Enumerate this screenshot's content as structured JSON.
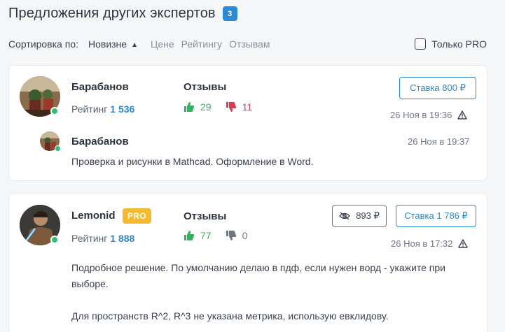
{
  "header": {
    "title": "Предложения других экспертов",
    "count": "3"
  },
  "sort": {
    "label": "Сортировка по:",
    "options": [
      "Новизне",
      "Цене",
      "Рейтингу",
      "Отзывам"
    ],
    "pro_only_label": "Только PRO"
  },
  "offers": [
    {
      "name": "Барабанов",
      "rating_label": "Рейтинг",
      "rating_value": "1 536",
      "reviews_label": "Отзывы",
      "reviews_up": "29",
      "reviews_down": "11",
      "bid_label": "Ставка 800 ₽",
      "time": "26 Ноя в 19:36",
      "message": {
        "name": "Барабанов",
        "time": "26 Ноя в 19:37",
        "text": "Проверка и рисунки в Mathcad. Оформление в Word."
      }
    },
    {
      "name": "Lemonid",
      "pro_label": "PRO",
      "rating_label": "Рейтинг",
      "rating_value": "1 888",
      "reviews_label": "Отзывы",
      "reviews_up": "77",
      "reviews_down": "0",
      "price_label": "893 ₽",
      "bid_label": "Ставка 1 786 ₽",
      "time": "26 Ноя в 17:32",
      "message": {
        "text_line1": "Подробное решение. По умолчанию делаю в пдф, если нужен ворд - укажите при",
        "text_line2": "выборе.",
        "text_line3": "Для пространств R^2, R^3 не указана метрика, использую евклидову."
      }
    }
  ],
  "colors": {
    "accent": "#2b8ad3",
    "positive": "#2fb35d",
    "negative": "#d43c57",
    "pro": "#f5b82e",
    "online": "#2fbf71"
  },
  "icons": [
    "thumbs-up-icon",
    "thumbs-down-icon",
    "warning-icon",
    "eye-icon",
    "caret-up-icon",
    "online-indicator"
  ]
}
